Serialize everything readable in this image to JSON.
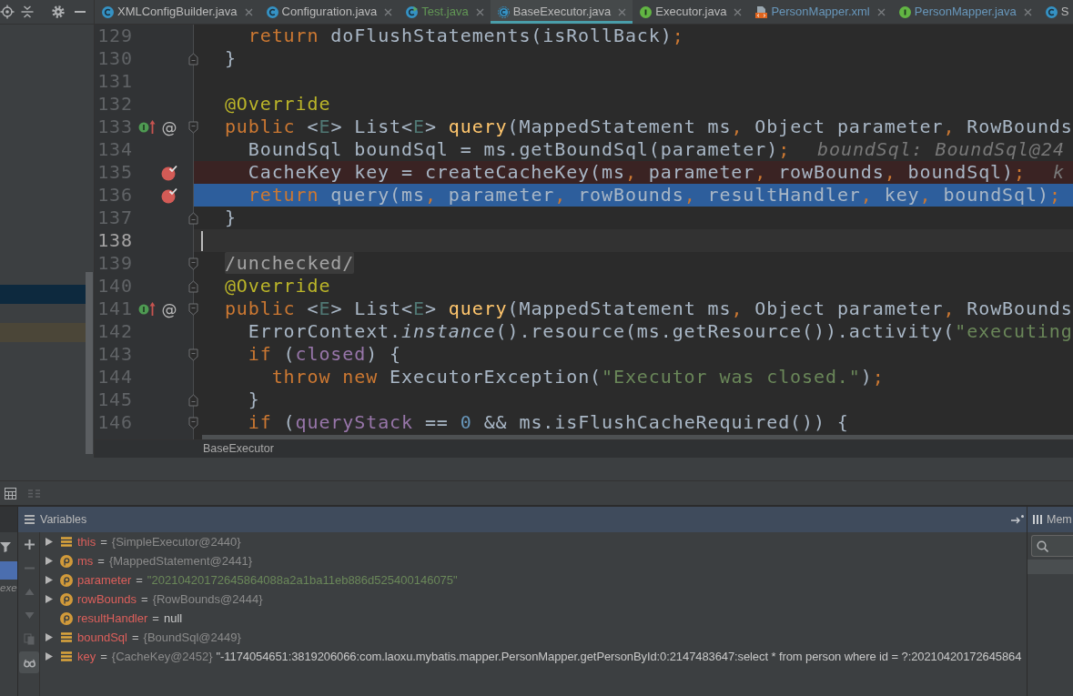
{
  "project_toolbar": [
    {
      "kind": "locate"
    },
    {
      "kind": "collapse"
    },
    {
      "kind": "settings"
    },
    {
      "kind": "hide"
    }
  ],
  "tabs": [
    {
      "label": "XMLConfigBuilder.java",
      "kind": "class",
      "color": "#bbbbbb",
      "selected": false,
      "close_icon": true
    },
    {
      "label": "Configuration.java",
      "kind": "class",
      "color": "#bbbbbb",
      "selected": false,
      "close_icon": true
    },
    {
      "label": "Test.java",
      "kind": "runnable-class",
      "color": "#629755",
      "selected": false,
      "close_icon": true
    },
    {
      "label": "BaseExecutor.java",
      "kind": "abstract-class",
      "color": "#bbbbbb",
      "selected": true,
      "close_icon": true
    },
    {
      "label": "Executor.java",
      "kind": "interface",
      "color": "#bbbbbb",
      "selected": false,
      "close_icon": true
    },
    {
      "label": "PersonMapper.xml",
      "kind": "xml",
      "color": "#6897bb",
      "selected": false,
      "close_icon": true
    },
    {
      "label": "PersonMapper.java",
      "kind": "interface",
      "color": "#6897bb",
      "selected": false,
      "close_icon": true
    },
    {
      "label": "S",
      "kind": "class",
      "color": "#bbbbbb",
      "selected": false,
      "close_icon": false
    }
  ],
  "project_tree": {
    "rows": [
      {
        "selected": true
      },
      {
        "selected": false
      },
      {
        "selected": false,
        "color": "#4b4638"
      }
    ]
  },
  "editor": {
    "lines": [
      {
        "number": "129",
        "kind": "plain",
        "tokens": [
          {
            "text": "    return",
            "kind": "keyword"
          },
          {
            "text": " doFlushStatements(isRollBack)",
            "kind": "plain"
          },
          {
            "text": ";",
            "kind": "punct"
          }
        ]
      },
      {
        "number": "130",
        "kind": "plain",
        "marks": [
          {
            "kind": "fold-end"
          }
        ],
        "tokens": [
          {
            "text": "  }",
            "kind": "plain"
          }
        ]
      },
      {
        "number": "131",
        "kind": "plain"
      },
      {
        "number": "132",
        "kind": "plain",
        "tokens": [
          {
            "text": "  @Override",
            "kind": "annotation"
          }
        ]
      },
      {
        "number": "133",
        "kind": "plain",
        "marks": [
          {
            "kind": "implements"
          },
          {
            "kind": "symbol",
            "text": "@"
          },
          {
            "kind": "fold-start"
          }
        ],
        "tokens": [
          {
            "text": "  public",
            "kind": "keyword"
          },
          {
            "text": " <",
            "kind": "plain"
          },
          {
            "text": "E",
            "kind": "type-param"
          },
          {
            "text": "> List<",
            "kind": "plain"
          },
          {
            "text": "E",
            "kind": "type-param"
          },
          {
            "text": "> ",
            "kind": "plain"
          },
          {
            "text": "query",
            "kind": "method"
          },
          {
            "text": "(MappedStatement ms",
            "kind": "plain"
          },
          {
            "text": ",",
            "kind": "punct"
          },
          {
            "text": " Object parameter",
            "kind": "plain"
          },
          {
            "text": ",",
            "kind": "punct"
          },
          {
            "text": " RowBounds",
            "kind": "plain"
          }
        ]
      },
      {
        "number": "134",
        "kind": "plain",
        "tokens": [
          {
            "text": "    BoundSql boundSql = ms.getBoundSql(parameter)",
            "kind": "plain"
          },
          {
            "text": ";",
            "kind": "punct"
          }
        ],
        "hint": "boundSql: BoundSql@24"
      },
      {
        "number": "135",
        "kind": "breakpoint",
        "marks": [
          {
            "kind": "breakpoint"
          }
        ],
        "tokens": [
          {
            "text": "    CacheKey key = createCacheKey(ms",
            "kind": "plain"
          },
          {
            "text": ",",
            "kind": "punct"
          },
          {
            "text": " parameter",
            "kind": "plain"
          },
          {
            "text": ",",
            "kind": "punct"
          },
          {
            "text": " rowBounds",
            "kind": "plain"
          },
          {
            "text": ",",
            "kind": "punct"
          },
          {
            "text": " boundSql)",
            "kind": "plain"
          },
          {
            "text": ";",
            "kind": "punct"
          }
        ],
        "hint": "k"
      },
      {
        "number": "136",
        "kind": "execution",
        "marks": [
          {
            "kind": "breakpoint"
          }
        ],
        "tokens": [
          {
            "text": "    return",
            "kind": "keyword"
          },
          {
            "text": " query(ms",
            "kind": "plain"
          },
          {
            "text": ",",
            "kind": "punct"
          },
          {
            "text": " parameter",
            "kind": "plain"
          },
          {
            "text": ",",
            "kind": "punct"
          },
          {
            "text": " rowBounds",
            "kind": "plain"
          },
          {
            "text": ",",
            "kind": "punct"
          },
          {
            "text": " resultHandler",
            "kind": "plain"
          },
          {
            "text": ",",
            "kind": "punct"
          },
          {
            "text": " key",
            "kind": "plain"
          },
          {
            "text": ",",
            "kind": "punct"
          },
          {
            "text": " boundSql)",
            "kind": "plain"
          },
          {
            "text": ";",
            "kind": "punct"
          }
        ]
      },
      {
        "number": "137",
        "kind": "plain",
        "marks": [
          {
            "kind": "fold-end"
          }
        ],
        "tokens": [
          {
            "text": "  }",
            "kind": "plain"
          }
        ]
      },
      {
        "number": "138",
        "kind": "current"
      },
      {
        "number": "139",
        "kind": "plain",
        "marks": [
          {
            "kind": "fold-start"
          }
        ],
        "tokens": [
          {
            "text": "  /unchecked/",
            "kind": "folded"
          }
        ]
      },
      {
        "number": "140",
        "kind": "plain",
        "marks": [
          {
            "kind": "fold-end"
          }
        ],
        "tokens": [
          {
            "text": "  @Override",
            "kind": "annotation"
          }
        ]
      },
      {
        "number": "141",
        "kind": "plain",
        "marks": [
          {
            "kind": "implements"
          },
          {
            "kind": "symbol",
            "text": "@"
          },
          {
            "kind": "fold-start"
          }
        ],
        "tokens": [
          {
            "text": "  public",
            "kind": "keyword"
          },
          {
            "text": " <",
            "kind": "plain"
          },
          {
            "text": "E",
            "kind": "type-param"
          },
          {
            "text": "> List<",
            "kind": "plain"
          },
          {
            "text": "E",
            "kind": "type-param"
          },
          {
            "text": "> ",
            "kind": "plain"
          },
          {
            "text": "query",
            "kind": "method"
          },
          {
            "text": "(MappedStatement ms",
            "kind": "plain"
          },
          {
            "text": ",",
            "kind": "punct"
          },
          {
            "text": " Object parameter",
            "kind": "plain"
          },
          {
            "text": ",",
            "kind": "punct"
          },
          {
            "text": " RowBounds",
            "kind": "plain"
          }
        ]
      },
      {
        "number": "142",
        "kind": "plain",
        "tokens": [
          {
            "text": "    ErrorContext.",
            "kind": "plain"
          },
          {
            "text": "instance",
            "kind": "static-call"
          },
          {
            "text": "().resource(ms.getResource()).activity(",
            "kind": "plain"
          },
          {
            "text": "\"executing",
            "kind": "string"
          }
        ]
      },
      {
        "number": "143",
        "kind": "plain",
        "marks": [
          {
            "kind": "fold-start"
          }
        ],
        "tokens": [
          {
            "text": "    if",
            "kind": "keyword"
          },
          {
            "text": " (",
            "kind": "plain"
          },
          {
            "text": "closed",
            "kind": "field"
          },
          {
            "text": ") {",
            "kind": "plain"
          }
        ]
      },
      {
        "number": "144",
        "kind": "plain",
        "tokens": [
          {
            "text": "      throw new",
            "kind": "keyword"
          },
          {
            "text": " ExecutorException(",
            "kind": "plain"
          },
          {
            "text": "\"Executor was closed.\"",
            "kind": "string"
          },
          {
            "text": ")",
            "kind": "plain"
          },
          {
            "text": ";",
            "kind": "punct"
          }
        ]
      },
      {
        "number": "145",
        "kind": "plain",
        "marks": [
          {
            "kind": "fold-end"
          }
        ],
        "tokens": [
          {
            "text": "    }",
            "kind": "plain"
          }
        ]
      },
      {
        "number": "146",
        "kind": "plain",
        "marks": [
          {
            "kind": "fold-start"
          }
        ],
        "tokens": [
          {
            "text": "    if",
            "kind": "keyword"
          },
          {
            "text": " (",
            "kind": "plain"
          },
          {
            "text": "queryStack",
            "kind": "field"
          },
          {
            "text": " == ",
            "kind": "plain"
          },
          {
            "text": "0",
            "kind": "number"
          },
          {
            "text": " && ms.isFlushCacheRequired()) {",
            "kind": "plain"
          }
        ]
      }
    ],
    "breadcrumb": [
      "BaseExecutor"
    ]
  },
  "debugger": {
    "toolbar": [
      {
        "kind": "table",
        "disabled": false
      },
      {
        "kind": "layout",
        "disabled": true
      }
    ],
    "frames": [
      {
        "selected": true
      },
      {
        "selected": false,
        "text": "exe"
      }
    ],
    "variables": {
      "title": "Variables",
      "toolbar": [
        {
          "kind": "add",
          "disabled": false,
          "toggled": false
        },
        {
          "kind": "remove",
          "disabled": true,
          "toggled": false
        },
        {
          "kind": "up",
          "disabled": true,
          "toggled": false
        },
        {
          "kind": "down",
          "disabled": true,
          "toggled": false
        },
        {
          "kind": "copy",
          "disabled": true,
          "toggled": false
        },
        {
          "kind": "watches",
          "disabled": false,
          "toggled": true
        }
      ],
      "rows": [
        {
          "name": "this",
          "kind": "field",
          "expandable": true,
          "expanded": false,
          "operator": "=",
          "value": {
            "text": "{SimpleExecutor@2440}",
            "kind": "object"
          }
        },
        {
          "name": "ms",
          "kind": "param",
          "expandable": true,
          "expanded": false,
          "operator": "=",
          "value": {
            "text": "{MappedStatement@2441}",
            "kind": "object"
          }
        },
        {
          "name": "parameter",
          "kind": "param",
          "expandable": true,
          "expanded": false,
          "operator": "=",
          "value": {
            "text": "\"20210420172645864088a2a1ba11eb886d525400146075\"",
            "kind": "string"
          }
        },
        {
          "name": "rowBounds",
          "kind": "param",
          "expandable": true,
          "expanded": false,
          "operator": "=",
          "value": {
            "text": "{RowBounds@2444}",
            "kind": "object"
          }
        },
        {
          "name": "resultHandler",
          "kind": "param",
          "expandable": false,
          "expanded": false,
          "operator": "=",
          "value": {
            "text": "null",
            "kind": "null"
          }
        },
        {
          "name": "boundSql",
          "kind": "field",
          "expandable": true,
          "expanded": false,
          "operator": "=",
          "value": {
            "text": "{BoundSql@2449}",
            "kind": "object"
          }
        },
        {
          "name": "key",
          "kind": "field",
          "expandable": true,
          "expanded": false,
          "operator": "=",
          "value": {
            "text": "{CacheKey@2452}",
            "kind": "object"
          },
          "detail": "\"-1174054651:3819206066:com.laoxu.mybatis.mapper.PersonMapper.getPersonById:0:2147483647:select * from person where id = ?:20210420172645864"
        }
      ]
    },
    "memory": {
      "title": "Mem"
    }
  }
}
